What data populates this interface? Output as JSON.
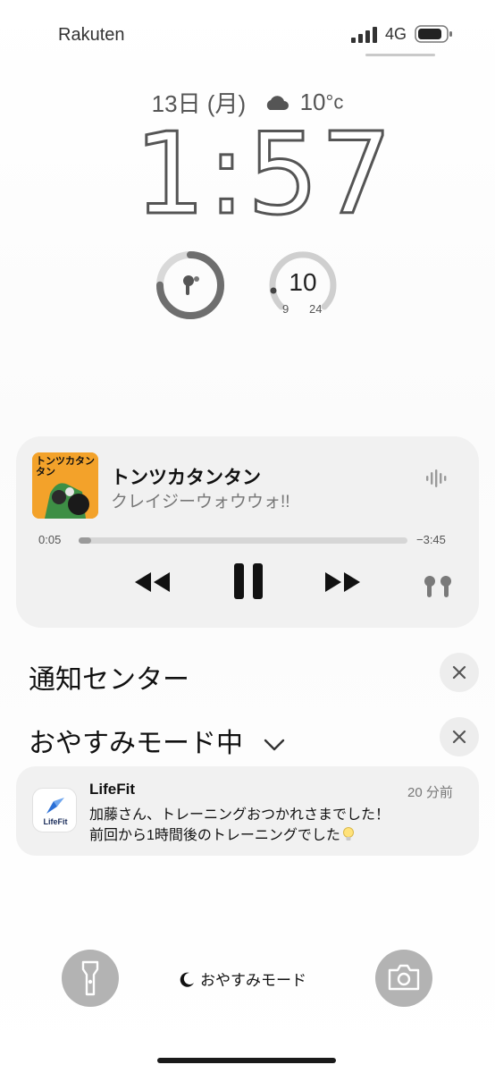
{
  "status_bar": {
    "carrier": "Rakuten",
    "network": "4G"
  },
  "lock_screen": {
    "date": "13日 (月)",
    "temperature": "10",
    "temp_unit": "°c",
    "time": "1:57",
    "widgets": {
      "airpods_battery_level": 0.75,
      "weather_current": "10",
      "weather_low": "9",
      "weather_high": "24"
    }
  },
  "now_playing": {
    "title": "トンツカタンタン",
    "artist": "クレイジーウォウウォ!!",
    "artwork_title": "トンツカタンタン",
    "elapsed": "0:05",
    "remaining": "−3:45",
    "progress": 0.022
  },
  "notification_center": {
    "title": "通知センター",
    "focus_title": "おやすみモード中"
  },
  "notification": {
    "app_name": "LifeFit",
    "app_logo_text": "LifeFit",
    "time_ago": "20 分前",
    "line1": "加藤さん、トレーニングおつかれさまでした！",
    "line2": "前回から1時間後のトレーニングでした"
  },
  "bottom_bar": {
    "focus_mode_label": "おやすみモード"
  },
  "colors": {
    "card_bg": "#f1f1f1",
    "artwork_bg": "#f3a22a",
    "button_gray": "#b3b3b3"
  },
  "icons": [
    "signal-icon",
    "battery-icon",
    "cloud-icon",
    "airpods-icon",
    "waveform-icon",
    "rewind-icon",
    "pause-icon",
    "forward-icon",
    "chevron-down-icon",
    "close-icon",
    "bulb-icon",
    "flashlight-icon",
    "moon-icon",
    "camera-icon"
  ]
}
